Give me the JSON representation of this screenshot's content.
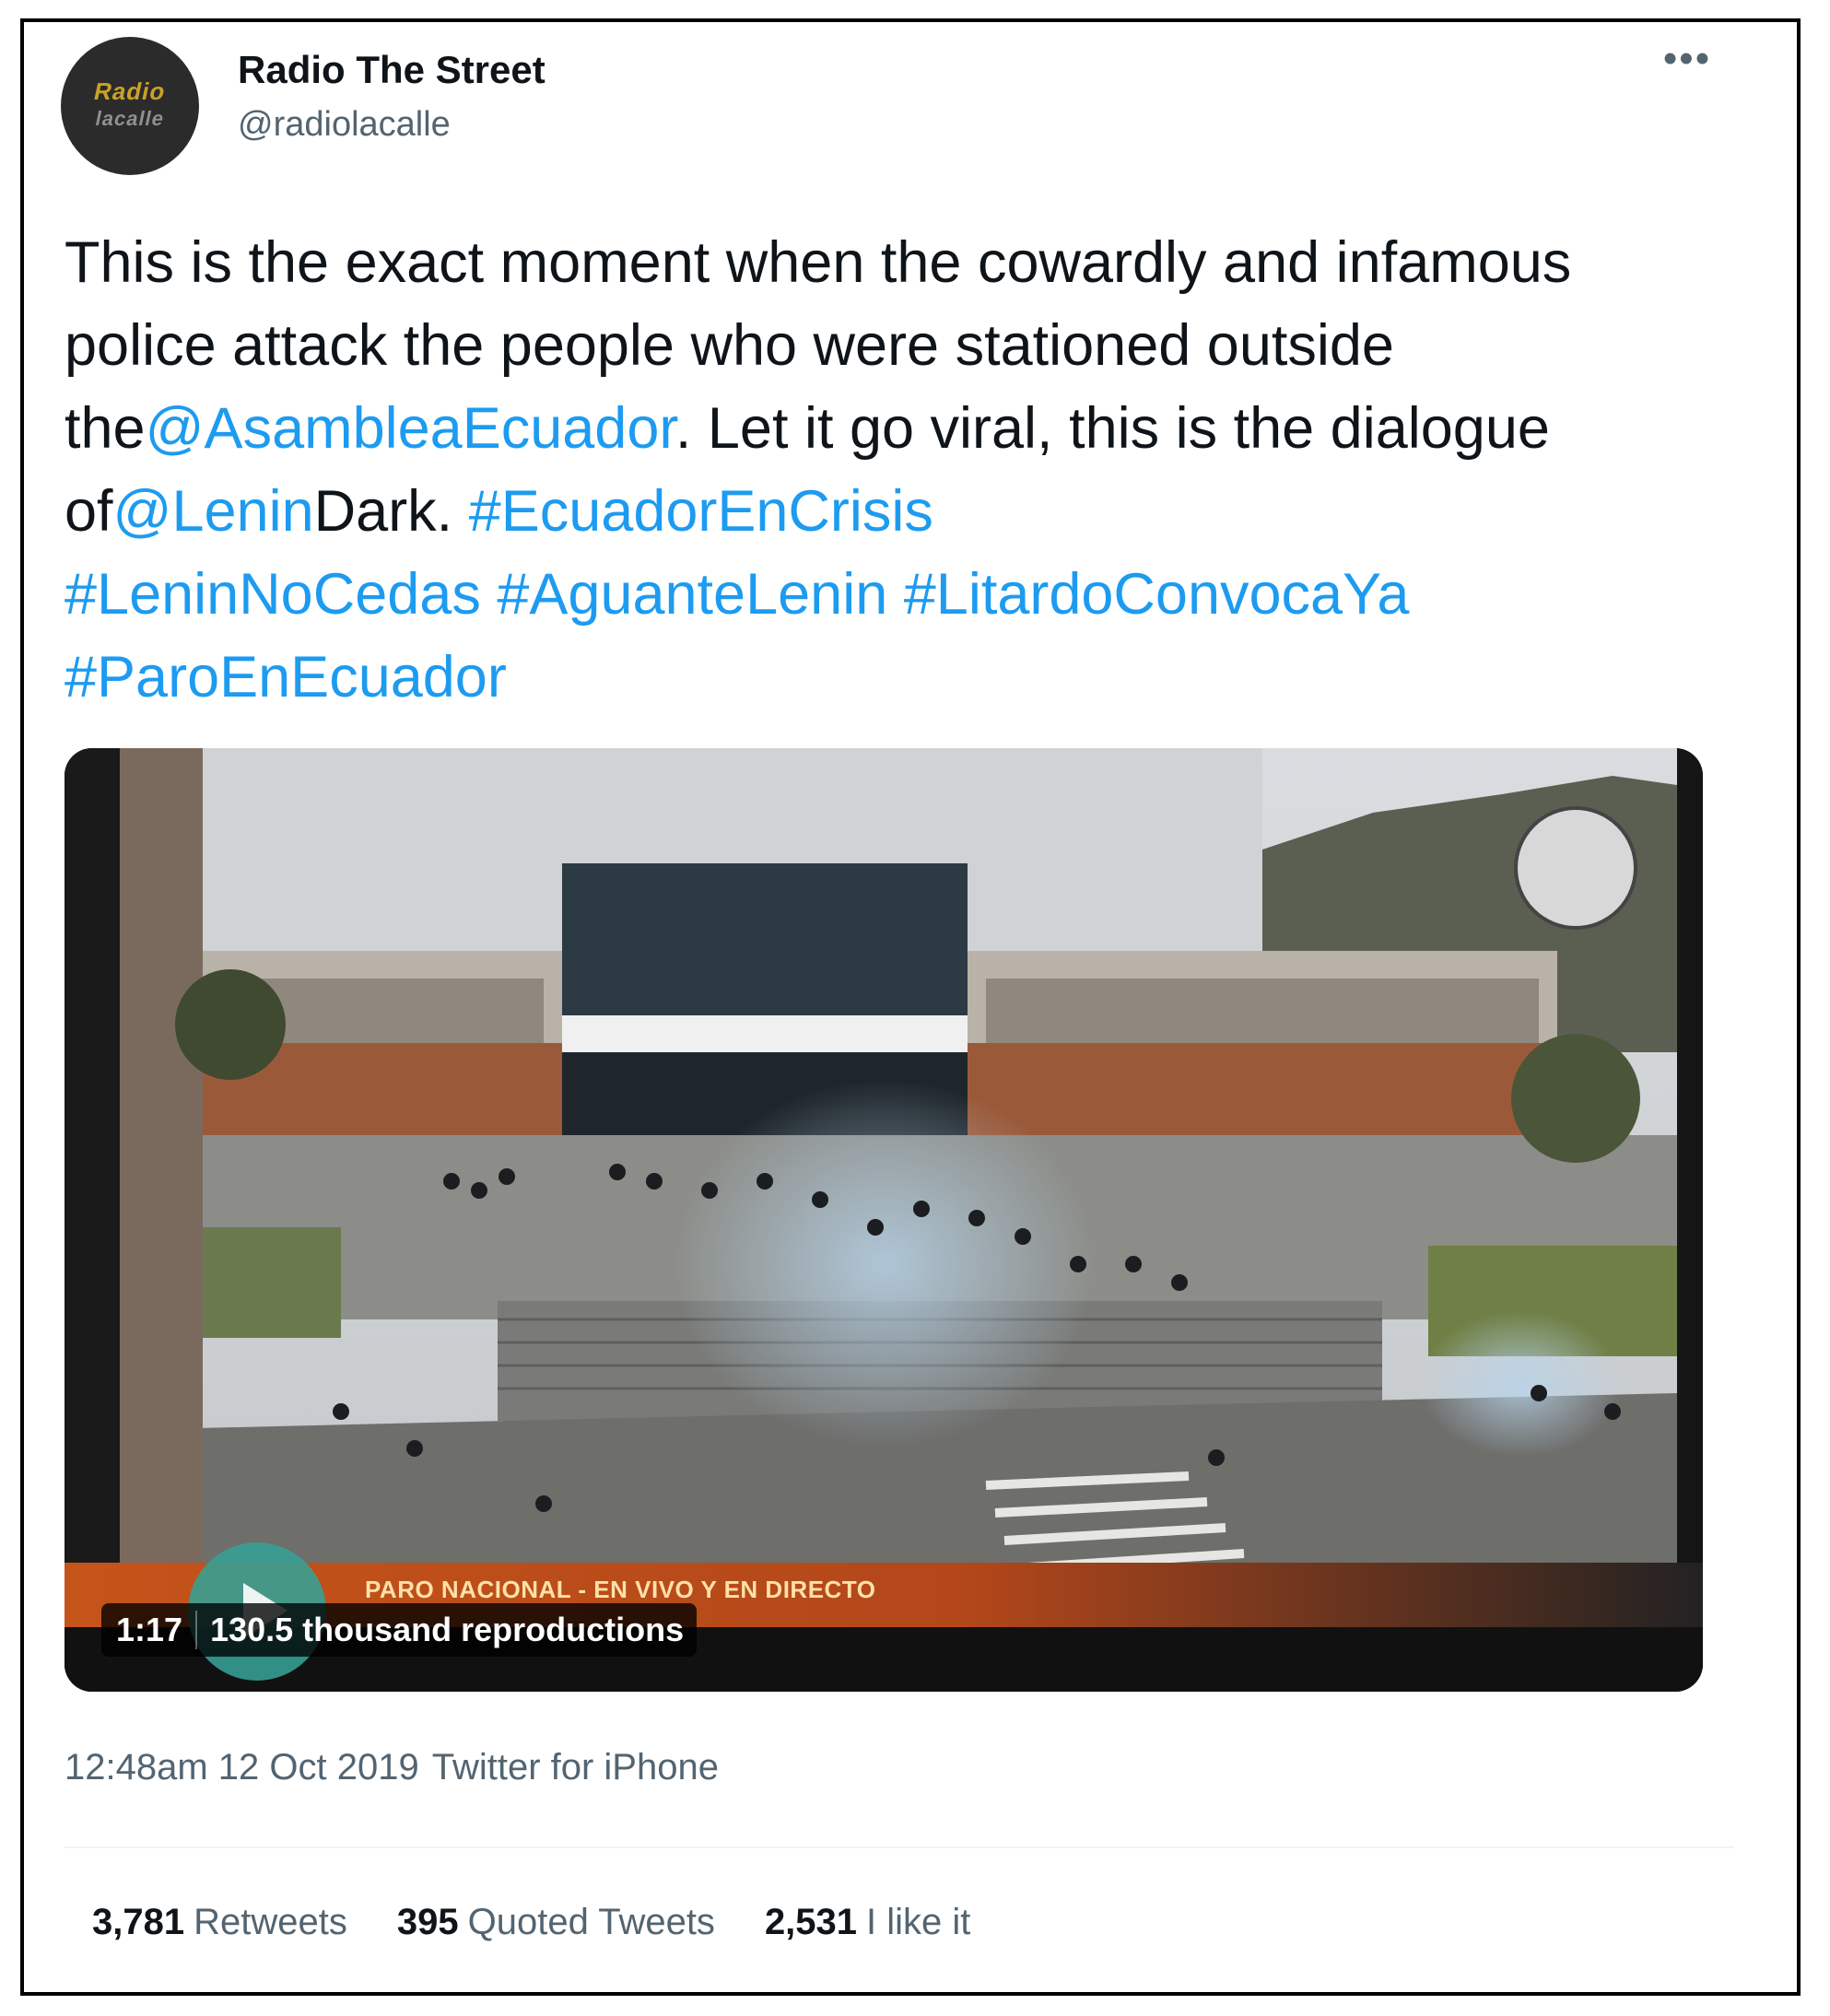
{
  "author": {
    "display_name": "Radio The Street",
    "handle": "@radiolacalle",
    "avatar_logo_top": "Radio",
    "avatar_logo_bottom": "lacalle"
  },
  "more_icon": "more-horizontal-icon",
  "tweet": {
    "t1": "This is the exact moment when the cowardly and infamous police attack the people who were stationed outside the",
    "m1": "@AsambleaEcuador",
    "t2": ". Let it go viral, this is the dialogue of",
    "m2": "@Lenin",
    "t3": "Dark. ",
    "h1": "#EcuadorEnCrisis",
    "h2": "#LeninNoCedas",
    "h3": "#AguanteLenin",
    "h4": "#LitardoConvocaYa",
    "h5": "#ParoEnEcuador"
  },
  "video": {
    "duration": "1:17",
    "views": "130.5 thousand reproductions",
    "ticker": "PARO NACIONAL - EN VIVO Y EN DIRECTO",
    "play_icon": "play-icon"
  },
  "meta": {
    "time": "12:48am 12 Oct 2019",
    "source": "Twitter  for iPhone"
  },
  "stats": {
    "retweets_count": "3,781",
    "retweets_label": "Retweets",
    "quoted_count": "395",
    "quoted_label": "Quoted Tweets",
    "likes_count": "2,531",
    "likes_label": "I like it"
  },
  "colors": {
    "link": "#1d9bf0",
    "text": "#0f1419",
    "secondary": "#536471"
  }
}
